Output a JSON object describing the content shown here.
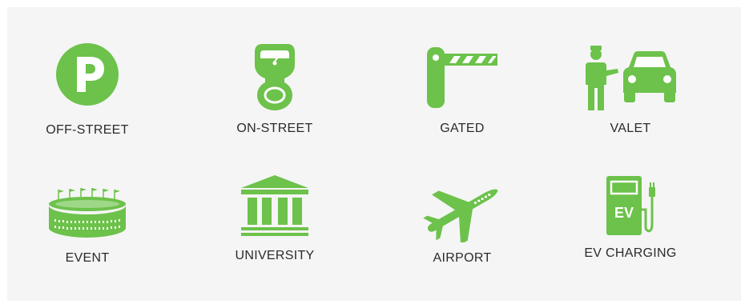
{
  "theme": {
    "accent": "#6cc24a",
    "panel_background": "#f5f5f5",
    "text_color": "#2b2b2b"
  },
  "parking_types": [
    {
      "label": "OFF-STREET",
      "icon": "parking-p-icon"
    },
    {
      "label": "ON-STREET",
      "icon": "parking-meter-icon"
    },
    {
      "label": "GATED",
      "icon": "gate-barrier-icon"
    },
    {
      "label": "VALET",
      "icon": "valet-car-icon"
    },
    {
      "label": "EVENT",
      "icon": "stadium-icon"
    },
    {
      "label": "UNIVERSITY",
      "icon": "university-building-icon"
    },
    {
      "label": "AIRPORT",
      "icon": "airplane-icon"
    },
    {
      "label": "EV CHARGING",
      "icon": "ev-charger-icon",
      "badge": "EV"
    }
  ]
}
